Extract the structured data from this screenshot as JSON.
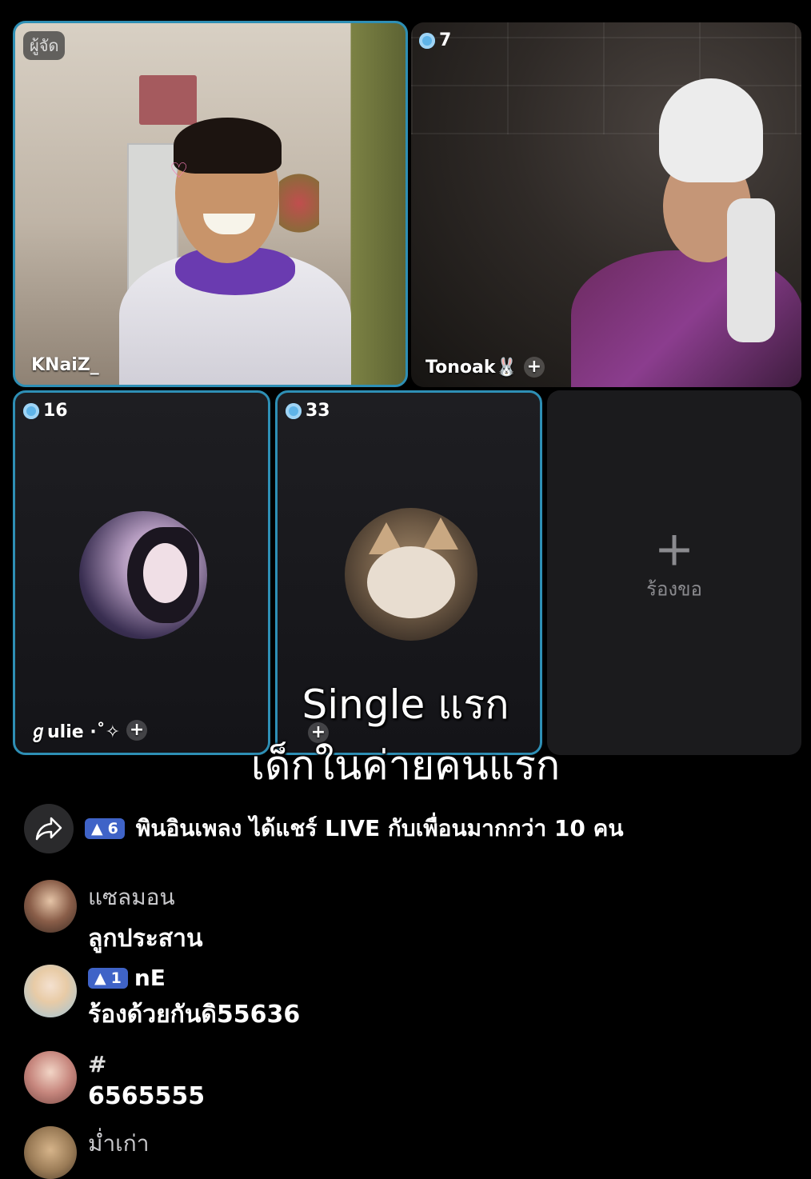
{
  "tiles": [
    {
      "host_tag": "ผู้จัด",
      "name": "KNaiZ_"
    },
    {
      "count": "7",
      "name": "Tonoak🐰"
    },
    {
      "count": "16",
      "name": "ℊulie ·˚✧"
    },
    {
      "count": "33",
      "name": ""
    },
    {
      "request_label": "ร้องขอ"
    }
  ],
  "caption": {
    "line1": "Single แรก",
    "line2": "เด็กในค่ายคนแรก"
  },
  "share_banner": {
    "level": "6",
    "text": "พินอินเพลง ได้แชร์ LIVE กับเพื่อนมากกว่า 10 คน"
  },
  "comments": [
    {
      "name": "แซลมอน",
      "level": null,
      "text": "ลูกประสาน"
    },
    {
      "name": "nE",
      "level": "1",
      "text": "ร้องด้วยกันดิ55636"
    },
    {
      "name": "#",
      "level": null,
      "text": "6565555"
    },
    {
      "name": "ม่ำเก่า",
      "level": null,
      "text": ""
    }
  ],
  "colors": {
    "active_border": "#2e8fb5",
    "level_pill": "#3f63c7"
  }
}
